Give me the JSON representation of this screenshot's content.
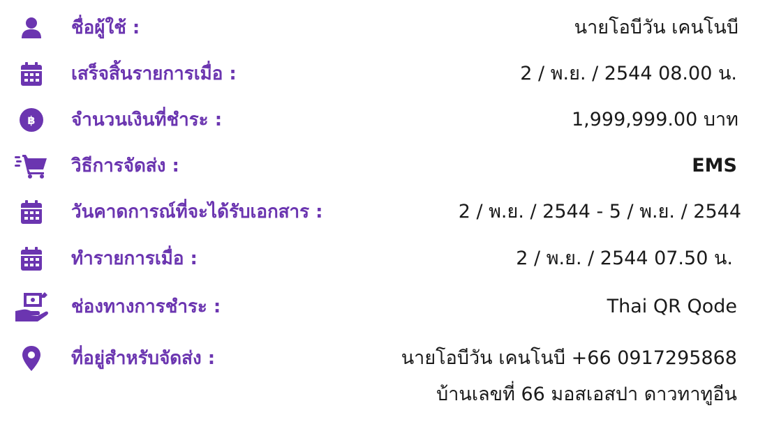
{
  "colors": {
    "accent": "#6b35b0",
    "text": "#1a1a1a",
    "background": "#ffffff"
  },
  "rows": [
    {
      "icon": "user-icon",
      "label": "ชื่อผู้ใช้ :",
      "value": "นายโอบีวัน เคนโนบี"
    },
    {
      "icon": "calendar-icon",
      "label": "เสร็จสิ้นรายการเมื่อ :",
      "value": "2 / พ.ย. / 2544 08.00 น."
    },
    {
      "icon": "baht-coin-icon",
      "label": "จำนวนเงินที่ชำระ :",
      "value": "1,999,999.00 บาท"
    },
    {
      "icon": "shopping-cart-fast-icon",
      "label": "วิธีการจัดส่ง :",
      "value": "EMS"
    },
    {
      "icon": "calendar-icon",
      "label": "วันคาดการณ์ที่จะได้รับเอกสาร :",
      "value": "2 / พ.ย. / 2544 - 5 / พ.ย. / 2544"
    },
    {
      "icon": "calendar-icon",
      "label": "ทำรายการเมื่อ :",
      "value": "2 / พ.ย. / 2544 07.50 น."
    },
    {
      "icon": "hand-money-icon",
      "label": "ช่องทางการชำระ :",
      "value": "Thai QR Qode"
    },
    {
      "icon": "location-pin-icon",
      "label": "ที่อยู่สำหรับจัดส่ง :",
      "value": "นายโอบีวัน เคนโนบี +66 0917295868",
      "value_line2": "บ้านเลขที่ 66 มอสเอสปา ดาวทาทูอีน"
    }
  ]
}
